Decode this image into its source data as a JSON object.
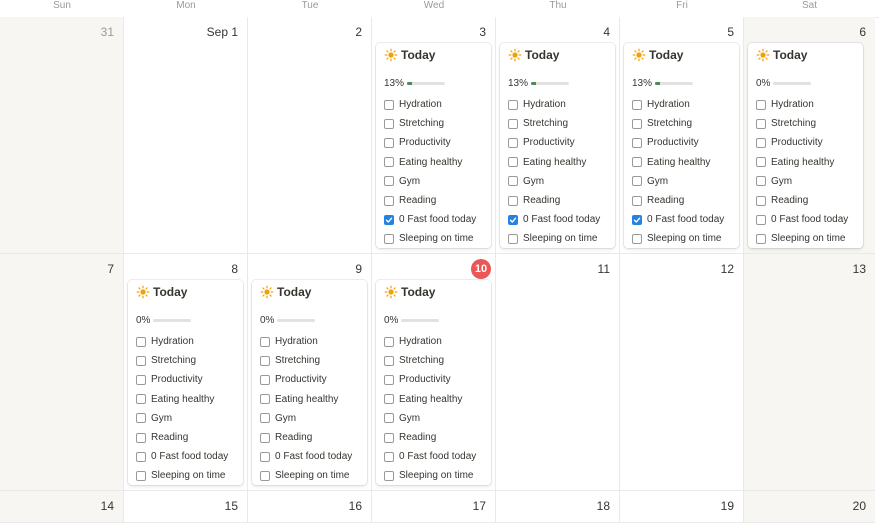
{
  "weekdays": [
    "Sun",
    "Mon",
    "Tue",
    "Wed",
    "Thu",
    "Fri",
    "Sat"
  ],
  "weeks": [
    {
      "days": [
        {
          "label": "31",
          "muted": true,
          "weekend": true,
          "card": null
        },
        {
          "label": "Sep 1",
          "card": null
        },
        {
          "label": "2",
          "card": null
        },
        {
          "label": "3",
          "card": {
            "title": "Today",
            "progress_text": "13%",
            "progress": 0.13,
            "tasks": [
              {
                "label": "Hydration",
                "checked": false
              },
              {
                "label": "Stretching",
                "checked": false
              },
              {
                "label": "Productivity",
                "checked": false
              },
              {
                "label": "Eating healthy",
                "checked": false
              },
              {
                "label": "Gym",
                "checked": false
              },
              {
                "label": "Reading",
                "checked": false
              },
              {
                "label": "0 Fast food today",
                "checked": true
              },
              {
                "label": "Sleeping on time",
                "checked": false
              }
            ]
          }
        },
        {
          "label": "4",
          "card": {
            "title": "Today",
            "progress_text": "13%",
            "progress": 0.13,
            "tasks": [
              {
                "label": "Hydration",
                "checked": false
              },
              {
                "label": "Stretching",
                "checked": false
              },
              {
                "label": "Productivity",
                "checked": false
              },
              {
                "label": "Eating healthy",
                "checked": false
              },
              {
                "label": "Gym",
                "checked": false
              },
              {
                "label": "Reading",
                "checked": false
              },
              {
                "label": "0 Fast food today",
                "checked": true
              },
              {
                "label": "Sleeping on time",
                "checked": false
              }
            ]
          }
        },
        {
          "label": "5",
          "card": {
            "title": "Today",
            "progress_text": "13%",
            "progress": 0.13,
            "tasks": [
              {
                "label": "Hydration",
                "checked": false
              },
              {
                "label": "Stretching",
                "checked": false
              },
              {
                "label": "Productivity",
                "checked": false
              },
              {
                "label": "Eating healthy",
                "checked": false
              },
              {
                "label": "Gym",
                "checked": false
              },
              {
                "label": "Reading",
                "checked": false
              },
              {
                "label": "0 Fast food today",
                "checked": true
              },
              {
                "label": "Sleeping on time",
                "checked": false
              }
            ]
          }
        },
        {
          "label": "6",
          "weekend": true,
          "card": {
            "title": "Today",
            "progress_text": "0%",
            "progress": 0,
            "tasks": [
              {
                "label": "Hydration",
                "checked": false
              },
              {
                "label": "Stretching",
                "checked": false
              },
              {
                "label": "Productivity",
                "checked": false
              },
              {
                "label": "Eating healthy",
                "checked": false
              },
              {
                "label": "Gym",
                "checked": false
              },
              {
                "label": "Reading",
                "checked": false
              },
              {
                "label": "0 Fast food today",
                "checked": false
              },
              {
                "label": "Sleeping on time",
                "checked": false
              }
            ]
          }
        }
      ]
    },
    {
      "days": [
        {
          "label": "7",
          "weekend": true,
          "card": null
        },
        {
          "label": "8",
          "card": {
            "title": "Today",
            "progress_text": "0%",
            "progress": 0,
            "tasks": [
              {
                "label": "Hydration",
                "checked": false
              },
              {
                "label": "Stretching",
                "checked": false
              },
              {
                "label": "Productivity",
                "checked": false
              },
              {
                "label": "Eating healthy",
                "checked": false
              },
              {
                "label": "Gym",
                "checked": false
              },
              {
                "label": "Reading",
                "checked": false
              },
              {
                "label": "0 Fast food today",
                "checked": false
              },
              {
                "label": "Sleeping on time",
                "checked": false
              }
            ]
          }
        },
        {
          "label": "9",
          "card": {
            "title": "Today",
            "progress_text": "0%",
            "progress": 0,
            "tasks": [
              {
                "label": "Hydration",
                "checked": false
              },
              {
                "label": "Stretching",
                "checked": false
              },
              {
                "label": "Productivity",
                "checked": false
              },
              {
                "label": "Eating healthy",
                "checked": false
              },
              {
                "label": "Gym",
                "checked": false
              },
              {
                "label": "Reading",
                "checked": false
              },
              {
                "label": "0 Fast food today",
                "checked": false
              },
              {
                "label": "Sleeping on time",
                "checked": false
              }
            ]
          }
        },
        {
          "label": "10",
          "today": true,
          "card": {
            "title": "Today",
            "progress_text": "0%",
            "progress": 0,
            "tasks": [
              {
                "label": "Hydration",
                "checked": false
              },
              {
                "label": "Stretching",
                "checked": false
              },
              {
                "label": "Productivity",
                "checked": false
              },
              {
                "label": "Eating healthy",
                "checked": false
              },
              {
                "label": "Gym",
                "checked": false
              },
              {
                "label": "Reading",
                "checked": false
              },
              {
                "label": "0 Fast food today",
                "checked": false
              },
              {
                "label": "Sleeping on time",
                "checked": false
              }
            ]
          }
        },
        {
          "label": "11",
          "card": null
        },
        {
          "label": "12",
          "card": null
        },
        {
          "label": "13",
          "weekend": true,
          "card": null
        }
      ]
    },
    {
      "days": [
        {
          "label": "14",
          "weekend": true,
          "card": null
        },
        {
          "label": "15",
          "card": null
        },
        {
          "label": "16",
          "card": null
        },
        {
          "label": "17",
          "card": null
        },
        {
          "label": "18",
          "card": null
        },
        {
          "label": "19",
          "card": null
        },
        {
          "label": "20",
          "weekend": true,
          "card": null
        }
      ]
    }
  ],
  "colors": {
    "today_badge": "#eb5757",
    "checkbox_checked": "#2383e2",
    "progress_fill": "#4a8c5a",
    "sun_icon": "#f2a007"
  }
}
